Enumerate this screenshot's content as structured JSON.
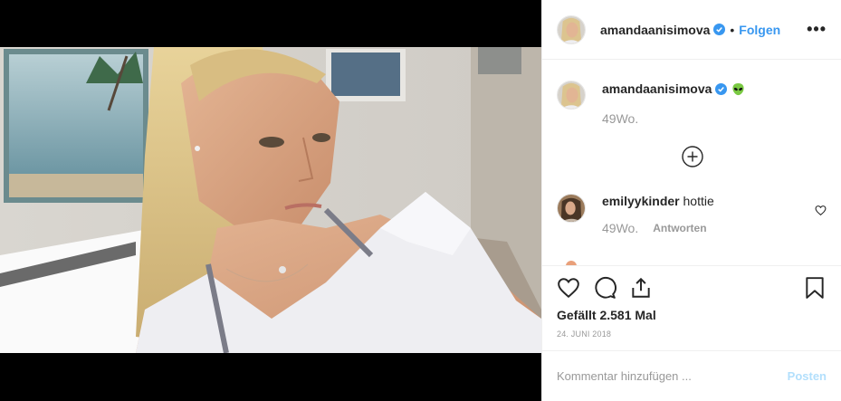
{
  "header": {
    "username": "amandaanisimova",
    "separator": "•",
    "follow_label": "Folgen",
    "more_label": "•••"
  },
  "caption": {
    "username": "amandaanisimova",
    "emoji": "alien-icon",
    "time": "49Wo."
  },
  "comments": [
    {
      "username": "emilyykinder",
      "text": "hottie",
      "time": "49Wo.",
      "reply_label": "Antworten"
    }
  ],
  "actions": {
    "likes": "Gefällt 2.581 Mal",
    "date": "24. JUNI 2018"
  },
  "composer": {
    "placeholder": "Kommentar hinzufügen ...",
    "post_label": "Posten"
  },
  "colors": {
    "accent": "#3897f0",
    "verified": "#3897f0",
    "post_disabled": "#b2dffc",
    "muted": "#999999",
    "text": "#262626"
  }
}
